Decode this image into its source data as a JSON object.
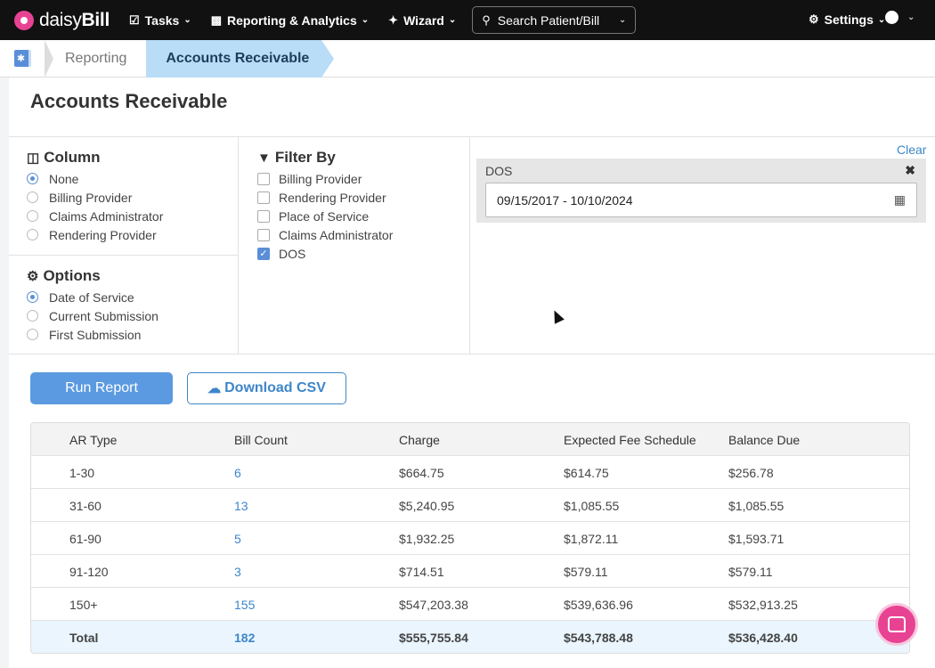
{
  "nav": {
    "logo_light": "daisy",
    "logo_bold": "Bill",
    "tasks": "Tasks",
    "reporting": "Reporting & Analytics",
    "wizard": "Wizard",
    "search_placeholder": "Search Patient/Bill",
    "settings": "Settings"
  },
  "breadcrumb": {
    "items": [
      "Reporting",
      "Accounts Receivable"
    ]
  },
  "page": {
    "title": "Accounts Receivable"
  },
  "column": {
    "title": "Column",
    "options": [
      "None",
      "Billing Provider",
      "Claims Administrator",
      "Rendering Provider"
    ],
    "selected": "None"
  },
  "options": {
    "title": "Options",
    "options": [
      "Date of Service",
      "Current Submission",
      "First Submission"
    ],
    "selected": "Date of Service"
  },
  "filter": {
    "title": "Filter By",
    "items": [
      {
        "label": "Billing Provider",
        "checked": false
      },
      {
        "label": "Rendering Provider",
        "checked": false
      },
      {
        "label": "Place of Service",
        "checked": false
      },
      {
        "label": "Claims Administrator",
        "checked": false
      },
      {
        "label": "DOS",
        "checked": true
      }
    ],
    "clear": "Clear",
    "dos_label": "DOS",
    "dos_value": "09/15/2017 - 10/10/2024"
  },
  "actions": {
    "run": "Run Report",
    "download": "Download CSV"
  },
  "table": {
    "headers": [
      "AR Type",
      "Bill Count",
      "Charge",
      "Expected Fee Schedule",
      "Balance Due"
    ],
    "rows": [
      [
        "1-30",
        "6",
        "$664.75",
        "$614.75",
        "$256.78"
      ],
      [
        "31-60",
        "13",
        "$5,240.95",
        "$1,085.55",
        "$1,085.55"
      ],
      [
        "61-90",
        "5",
        "$1,932.25",
        "$1,872.11",
        "$1,593.71"
      ],
      [
        "91-120",
        "3",
        "$714.51",
        "$579.11",
        "$579.11"
      ],
      [
        "150+",
        "155",
        "$547,203.38",
        "$539,636.96",
        "$532,913.25"
      ]
    ],
    "total": [
      "Total",
      "182",
      "$555,755.84",
      "$543,788.48",
      "$536,428.40"
    ]
  },
  "colors": {
    "accent": "#5b9ae0",
    "brand": "#e84393",
    "link": "#3e86c9"
  },
  "icons": {
    "tasks": "clipboard-icon",
    "reporting": "bar-chart-icon",
    "wizard": "magic-wand-icon",
    "search": "search-icon",
    "settings": "gear-icon",
    "user": "user-circle-icon",
    "calendar": "calendar-icon",
    "download": "cloud-download-icon",
    "chat": "chat-icon"
  }
}
